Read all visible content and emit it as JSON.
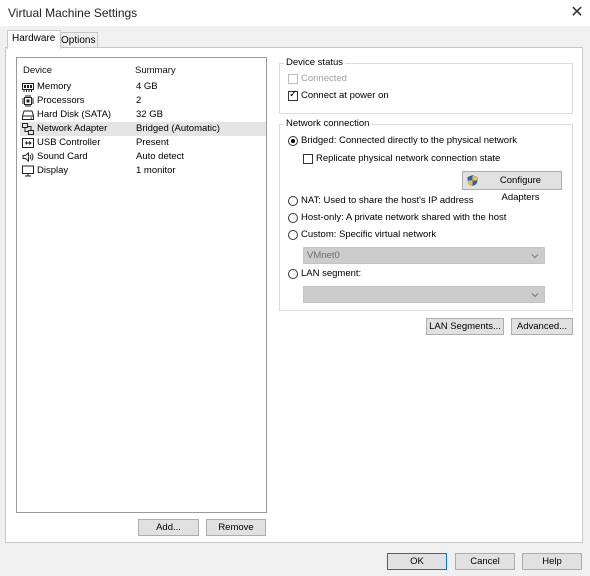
{
  "window": {
    "title": "Virtual Machine Settings"
  },
  "tabs": [
    {
      "label": "Hardware",
      "active": true
    },
    {
      "label": "Options",
      "active": false
    }
  ],
  "device_list": {
    "headers": {
      "device": "Device",
      "summary": "Summary"
    },
    "items": [
      {
        "name": "Memory",
        "summary": "4 GB",
        "icon": "memory-icon"
      },
      {
        "name": "Processors",
        "summary": "2",
        "icon": "processor-icon"
      },
      {
        "name": "Hard Disk (SATA)",
        "summary": "32 GB",
        "icon": "hard-disk-icon"
      },
      {
        "name": "Network Adapter",
        "summary": "Bridged (Automatic)",
        "icon": "network-adapter-icon",
        "selected": true
      },
      {
        "name": "USB Controller",
        "summary": "Present",
        "icon": "usb-icon"
      },
      {
        "name": "Sound Card",
        "summary": "Auto detect",
        "icon": "speaker-icon"
      },
      {
        "name": "Display",
        "summary": "1 monitor",
        "icon": "monitor-icon"
      }
    ],
    "add_label": "Add...",
    "remove_label": "Remove"
  },
  "device_status": {
    "title": "Device status",
    "connected": {
      "label": "Connected",
      "checked": false,
      "enabled": false
    },
    "connect_at_power_on": {
      "label": "Connect at power on",
      "checked": true,
      "enabled": true
    }
  },
  "network_connection": {
    "title": "Network connection",
    "bridged": {
      "label": "Bridged: Connected directly to the physical network",
      "selected": true
    },
    "replicate": {
      "label": "Replicate physical network connection state",
      "checked": false
    },
    "configure_label": "Configure Adapters",
    "nat": {
      "label": "NAT: Used to share the host's IP address",
      "selected": false
    },
    "host_only": {
      "label": "Host-only: A private network shared with the host",
      "selected": false
    },
    "custom": {
      "label": "Custom: Specific virtual network",
      "selected": false
    },
    "vmnet_value": "VMnet0",
    "lan_segment": {
      "label": "LAN segment:",
      "selected": false
    },
    "lan_value": ""
  },
  "buttons": {
    "lan_segments": "LAN Segments...",
    "advanced": "Advanced...",
    "ok": "OK",
    "cancel": "Cancel",
    "help": "Help"
  },
  "colors": {
    "accent": "#0078d7",
    "selection": "#e5e5e5",
    "disabled_text": "#a0a0a0"
  }
}
